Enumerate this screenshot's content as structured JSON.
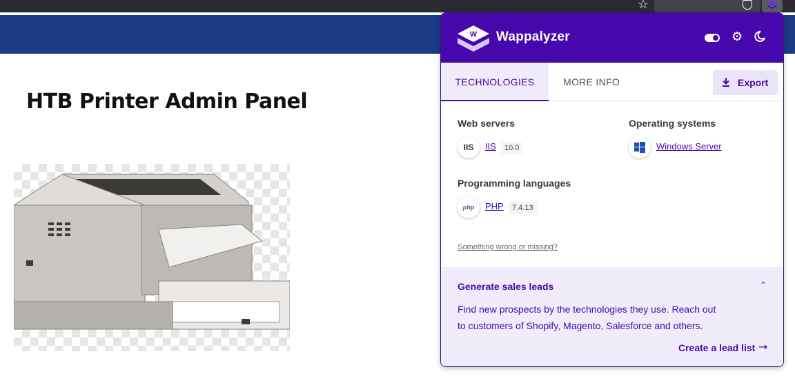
{
  "page": {
    "title": "HTB Printer Admin Panel"
  },
  "browser": {
    "icons": [
      "bookmark-star-icon",
      "shield-icon",
      "wappalyzer-extension-icon",
      "menu-icon"
    ]
  },
  "wappalyzer": {
    "brand": "Wappalyzer",
    "accent_color": "#4608ad",
    "tabs": [
      {
        "label": "TECHNOLOGIES",
        "active": true
      },
      {
        "label": "MORE INFO",
        "active": false
      }
    ],
    "export_label": "Export",
    "categories": [
      {
        "name": "Web servers",
        "items": [
          {
            "icon_text": "IIS",
            "name": "IIS",
            "version": "10.0"
          }
        ]
      },
      {
        "name": "Operating systems",
        "items": [
          {
            "icon_text": "",
            "name": "Windows Server",
            "version": ""
          }
        ]
      },
      {
        "name": "Programming languages",
        "items": [
          {
            "icon_text": "php",
            "name": "PHP",
            "version": "7.4.13"
          }
        ]
      }
    ],
    "feedback_link": "Something wrong or missing?",
    "leads": {
      "title": "Generate sales leads",
      "line1": "Find new prospects by the technologies they use. Reach out",
      "line2": "to customers of Shopify, Magento, Salesforce and others.",
      "link": "Create a lead list"
    }
  }
}
